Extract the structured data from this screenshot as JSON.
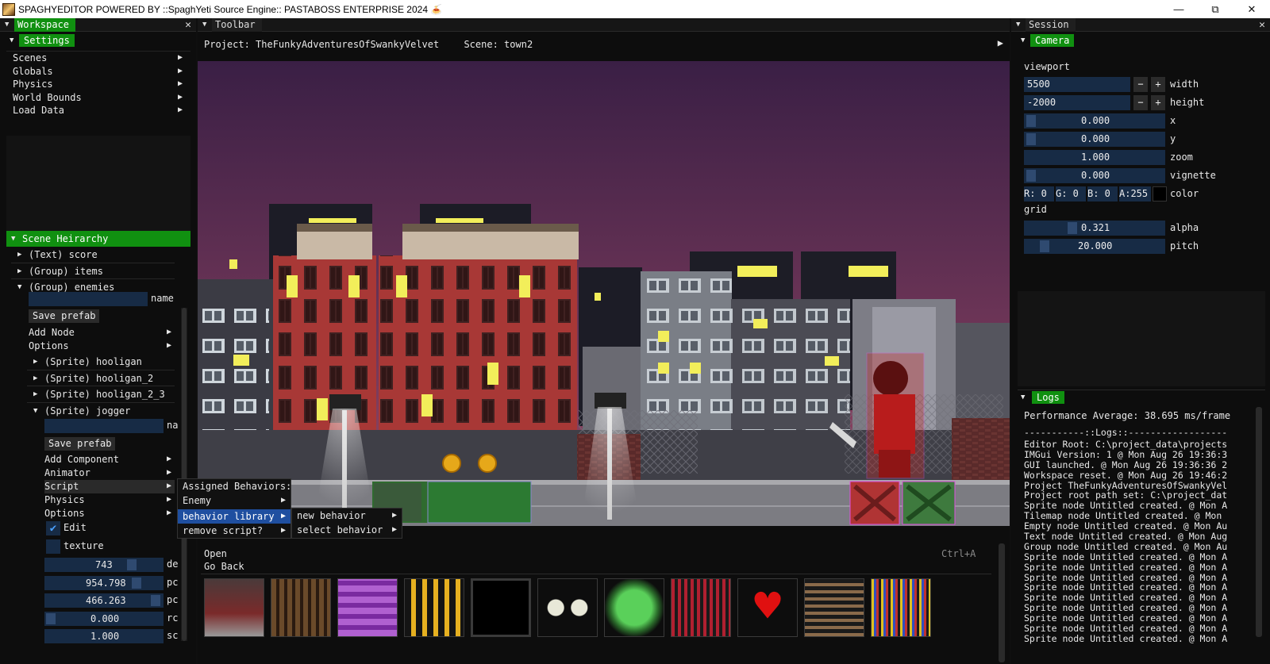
{
  "window": {
    "title": "SPAGHYEDITOR POWERED BY ::SpaghYeti Source Engine:: PASTABOSS ENTERPRISE 2024 🍝",
    "minimize": "—",
    "maximize": "⧉",
    "close": "✕"
  },
  "workspace": {
    "title": "Workspace",
    "close": "✕",
    "settings": {
      "title": "Settings",
      "items": [
        {
          "label": "Scenes",
          "arrow": "▶"
        },
        {
          "label": "Globals",
          "arrow": "▶"
        },
        {
          "label": "Physics",
          "arrow": "▶"
        },
        {
          "label": "World Bounds",
          "arrow": "▶"
        },
        {
          "label": "Load Data",
          "arrow": "▶"
        }
      ]
    },
    "hierarchy": {
      "title": "Scene Heirarchy",
      "rows": [
        "(Text) score",
        "(Group) items",
        "(Group) enemies"
      ],
      "enemies_name_label": "name",
      "save_prefab": "Save prefab",
      "add_node": "Add Node",
      "options": "Options",
      "sprites": [
        "(Sprite) hooligan",
        "(Sprite) hooligan_2",
        "(Sprite) hooligan_2_3",
        "(Sprite) jogger"
      ],
      "jogger_name_label": "na",
      "jogger_save_prefab": "Save prefab",
      "jogger_menu": [
        "Add Component",
        "Animator",
        "Script",
        "Physics",
        "Options"
      ],
      "edit_label": "Edit",
      "texture_label": "texture",
      "values": [
        {
          "value": "743",
          "label": "de"
        },
        {
          "value": "954.798",
          "label": "pc"
        },
        {
          "value": "466.263",
          "label": "pc"
        },
        {
          "value": "0.000",
          "label": "rc"
        },
        {
          "value": "1.000",
          "label": "sc"
        }
      ]
    }
  },
  "toolbar": {
    "title": "Toolbar",
    "project_label": "Project:",
    "project_name": "TheFunkyAdventuresOfSwankyVelvet",
    "scene_label": "Scene:",
    "scene_name": "town2",
    "play": "▶"
  },
  "script_menu": {
    "assigned": "Assigned Behaviors:",
    "enemy": "Enemy",
    "behavior_library": "behavior library",
    "remove_script": "remove script?",
    "library_sub": [
      "new behavior",
      "select behavior"
    ]
  },
  "assets": {
    "open": "Open",
    "go_back": "Go Back",
    "shortcut": "Ctrl+A"
  },
  "session": {
    "title": "Session",
    "close": "✕",
    "camera": {
      "title": "Camera",
      "viewport_label": "viewport",
      "width_value": "5500",
      "width_label": "width",
      "height_value": "-2000",
      "height_label": "height",
      "minus": "−",
      "plus": "+",
      "x_value": "0.000",
      "x_label": "x",
      "y_value": "0.000",
      "y_label": "y",
      "zoom_value": "1.000",
      "zoom_label": "zoom",
      "vignette_value": "0.000",
      "vignette_label": "vignette",
      "r": "R:   0",
      "g": "G:   0",
      "b": "B:   0",
      "a": "A:255",
      "color_label": "color",
      "grid_label": "grid",
      "alpha_value": "0.321",
      "alpha_label": "alpha",
      "alpha_level": 0.321,
      "pitch_value": "20.000",
      "pitch_label": "pitch"
    },
    "logs": {
      "title": "Logs",
      "performance": "Performance Average: 38.695 ms/frame",
      "separator": "-----------::Logs::------------------",
      "lines": [
        "Editor Root: C:\\project_data\\projects",
        "IMGui Version: 1 @ Mon Aug 26 19:36:3",
        "GUI launched. @ Mon Aug 26 19:36:36 2",
        "Workspace reset. @ Mon Aug 26 19:46:2",
        "Project TheFunkyAdventuresOfSwankyVel",
        "Project root path set: C:\\project_dat",
        "Sprite node Untitled created. @ Mon A",
        "Tilemap node Untitled created. @ Mon",
        "Empty node Untitled created. @ Mon Au",
        "Text node Untitled created. @ Mon Aug",
        "Group node Untitled created. @ Mon Au",
        "Sprite node Untitled created. @ Mon A",
        "Sprite node Untitled created. @ Mon A",
        "Sprite node Untitled created. @ Mon A",
        "Sprite node Untitled created. @ Mon A",
        "Sprite node Untitled created. @ Mon A",
        "Sprite node Untitled created. @ Mon A",
        "Sprite node Untitled created. @ Mon A",
        "Sprite node Untitled created. @ Mon A",
        "Sprite node Untitled created. @ Mon A"
      ]
    }
  },
  "colors": {
    "accent_green": "#109010",
    "field_blue": "#172b45",
    "highlight_blue": "#1f4fa0",
    "sky_top": "#3a1f45",
    "sky_bottom": "#9a4a66"
  }
}
